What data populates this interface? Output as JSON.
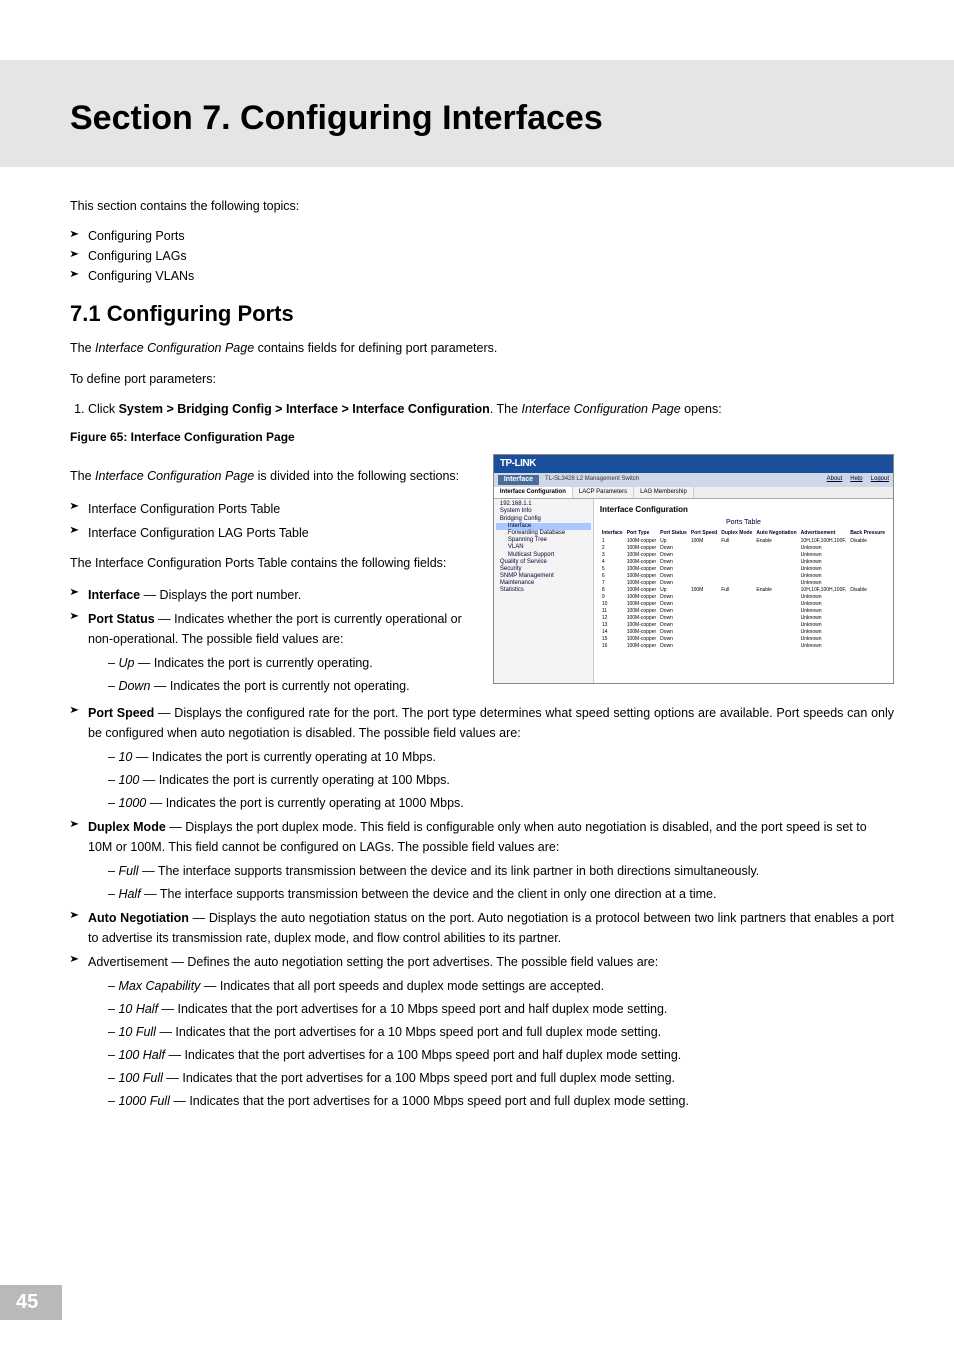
{
  "page_number": "45",
  "section_title": "Section 7.  Configuring Interfaces",
  "intro": "This section contains the following topics:",
  "topics": [
    "Configuring Ports",
    "Configuring LAGs",
    "Configuring VLANs"
  ],
  "h2": "7.1   Configuring Ports",
  "p1_prefix": "The ",
  "p1_em": "Interface Configuration Page",
  "p1_suffix": " contains fields for defining port parameters.",
  "p2": "To define port parameters:",
  "step1_a": "Click ",
  "step1_bold": "System > Bridging Config > Interface > Interface Configuration",
  "step1_b": ". The ",
  "step1_em": "Interface Configuration Page",
  "step1_c": " opens:",
  "fig_caption": "Figure 65: Interface Configuration Page",
  "left_p1_a": "The ",
  "left_p1_em": "Interface Configuration Page",
  "left_p1_b": " is divided into the following sections:",
  "left_bullets": [
    "Interface Configuration Ports Table",
    "Interface Configuration LAG Ports Table"
  ],
  "left_p2": "The Interface Configuration Ports Table contains the following fields:",
  "field_interface_b": "Interface",
  "field_interface_t": " — Displays the port number.",
  "field_portstatus_b": "Port Status",
  "field_portstatus_t": " — Indicates whether the port is currently operational or non-operational. The possible field values are:",
  "sub_up_em": "Up",
  "sub_up_t": " — Indicates the port is currently operating.",
  "sub_down_em": "Down",
  "sub_down_t": " — Indicates the port is currently not operating.",
  "field_portspeed_b": "Port Speed",
  "field_portspeed_t": " — Displays the configured rate for the port. The port type determines what speed setting options are available. Port speeds can only be configured when auto negotiation is disabled. The possible field values are:",
  "sub_10_em": "10",
  "sub_10_t": " — Indicates the port is currently operating at 10 Mbps.",
  "sub_100_em": "100",
  "sub_100_t": " — Indicates the port is currently operating at 100 Mbps.",
  "sub_1000_em": "1000",
  "sub_1000_t": " — Indicates the port is currently operating at 1000 Mbps.",
  "field_duplex_b": "Duplex Mode",
  "field_duplex_t": " — Displays the port duplex mode. This field is configurable only when auto negotiation is disabled, and the port speed is set to 10M or 100M. This field cannot be configured on LAGs. The possible field values are:",
  "sub_full_em": "Full",
  "sub_full_t": " — The interface supports transmission between the device and its link partner in both directions simultaneously.",
  "sub_half_em": "Half",
  "sub_half_t": " — The interface supports transmission between the device and the client in only one direction at a time.",
  "field_auto_b": "Auto Negotiation",
  "field_auto_t": " — Displays the auto negotiation status on the port. Auto negotiation is a protocol between two link partners that enables a port to advertise its transmission rate, duplex mode, and flow control abilities to its partner.",
  "field_adv_t": "Advertisement — Defines the auto negotiation setting the port advertises. The possible field values are:",
  "sub_max_em": "Max Capability",
  "sub_max_t": " — Indicates that all port speeds and duplex mode settings are accepted.",
  "sub_10h_em": "10 Half",
  "sub_10h_t": " — Indicates that the port advertises for a 10 Mbps speed port and half duplex mode setting.",
  "sub_10f_em": "10 Full",
  "sub_10f_t": " — Indicates that the port advertises for a 10 Mbps speed port and full duplex mode setting.",
  "sub_100h_em": "100 Half",
  "sub_100h_t": " — Indicates that the port advertises for a 100 Mbps speed port and half duplex mode setting.",
  "sub_100f_em": "100 Full",
  "sub_100f_t": " — Indicates that the port advertises for a 100 Mbps speed port and full duplex mode setting.",
  "sub_1000f_em": "1000 Full",
  "sub_1000f_t": " — Indicates that the port advertises for a 1000 Mbps speed port and full duplex mode setting.",
  "dash": "– ",
  "screenshot": {
    "logo": "TP-LINK",
    "module_label": "Interface",
    "device": "TL-SL3428 L2 Management Switch",
    "links": [
      "About",
      "Help",
      "Logout"
    ],
    "tabs": [
      "Interface Configuration",
      "LACP Parameters",
      "LAG Membership"
    ],
    "side_ip": "192.168.1.1",
    "side_items": [
      "System Info",
      "Bridging Config",
      "Interface",
      "Forwarding Database",
      "Spanning Tree",
      "VLAN",
      "Multicast Support",
      "Quality of Service",
      "Security",
      "SNMP Management",
      "Maintenance",
      "Statistics"
    ],
    "main_title": "Interface Configuration",
    "ports_table_title": "Ports Table",
    "headers": [
      "Interface",
      "Port Type",
      "Port Status",
      "Port Speed",
      "Duplex Mode",
      "Auto Negotiation",
      "Advertisement",
      "Back Pressure"
    ],
    "rows": [
      [
        "1",
        "100M-copper",
        "Up",
        "100M",
        "Full",
        "Enable",
        "10H,10F,100H,100F,",
        "Disable"
      ],
      [
        "2",
        "100M-copper",
        "Down",
        "",
        "",
        "",
        "Unknown",
        ""
      ],
      [
        "3",
        "100M-copper",
        "Down",
        "",
        "",
        "",
        "Unknown",
        ""
      ],
      [
        "4",
        "100M-copper",
        "Down",
        "",
        "",
        "",
        "Unknown",
        ""
      ],
      [
        "5",
        "100M-copper",
        "Down",
        "",
        "",
        "",
        "Unknown",
        ""
      ],
      [
        "6",
        "100M-copper",
        "Down",
        "",
        "",
        "",
        "Unknown",
        ""
      ],
      [
        "7",
        "100M-copper",
        "Down",
        "",
        "",
        "",
        "Unknown",
        ""
      ],
      [
        "8",
        "100M-copper",
        "Up",
        "100M",
        "Full",
        "Enable",
        "10H,10F,100H,100F,",
        "Disable"
      ],
      [
        "9",
        "100M-copper",
        "Down",
        "",
        "",
        "",
        "Unknown",
        ""
      ],
      [
        "10",
        "100M-copper",
        "Down",
        "",
        "",
        "",
        "Unknown",
        ""
      ],
      [
        "11",
        "100M-copper",
        "Down",
        "",
        "",
        "",
        "Unknown",
        ""
      ],
      [
        "12",
        "100M-copper",
        "Down",
        "",
        "",
        "",
        "Unknown",
        ""
      ],
      [
        "13",
        "100M-copper",
        "Down",
        "",
        "",
        "",
        "Unknown",
        ""
      ],
      [
        "14",
        "100M-copper",
        "Down",
        "",
        "",
        "",
        "Unknown",
        ""
      ],
      [
        "15",
        "100M-copper",
        "Down",
        "",
        "",
        "",
        "Unknown",
        ""
      ],
      [
        "16",
        "100M-copper",
        "Down",
        "",
        "",
        "",
        "Unknown",
        ""
      ]
    ]
  }
}
